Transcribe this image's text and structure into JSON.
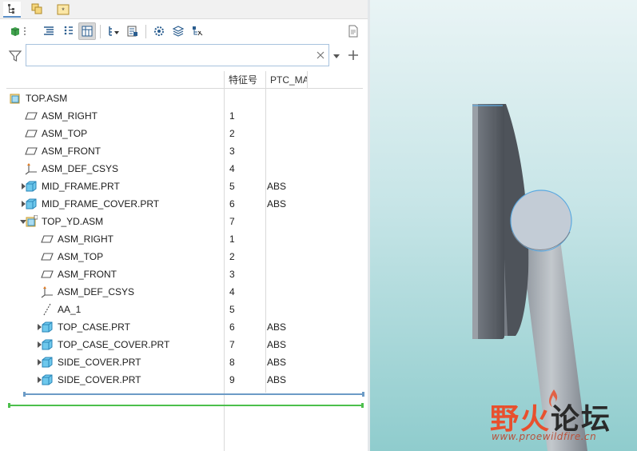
{
  "top_tabs": [
    {
      "name": "model-tree",
      "active": true
    },
    {
      "name": "layers",
      "active": false
    },
    {
      "name": "favorites",
      "active": false
    }
  ],
  "toolbar": {
    "buttons": [
      "show-display",
      "tree-columns",
      "tree-filters",
      "settings-table",
      "expand-filter",
      "model-info",
      "regenerate-settings",
      "layers-view",
      "tree-settings",
      "preview-doc"
    ]
  },
  "search": {
    "value": "",
    "placeholder": ""
  },
  "columns": {
    "feature_id": "特征号",
    "ptc": "PTC_MA"
  },
  "tree": [
    {
      "label": "TOP.ASM",
      "id": "",
      "ptc": "",
      "icon": "assembly",
      "level": 0,
      "arrow": ""
    },
    {
      "label": "ASM_RIGHT",
      "id": "1",
      "ptc": "",
      "icon": "plane",
      "level": 1,
      "arrow": ""
    },
    {
      "label": "ASM_TOP",
      "id": "2",
      "ptc": "",
      "icon": "plane",
      "level": 1,
      "arrow": ""
    },
    {
      "label": "ASM_FRONT",
      "id": "3",
      "ptc": "",
      "icon": "plane",
      "level": 1,
      "arrow": ""
    },
    {
      "label": "ASM_DEF_CSYS",
      "id": "4",
      "ptc": "",
      "icon": "csys",
      "level": 1,
      "arrow": ""
    },
    {
      "label": "MID_FRAME.PRT",
      "id": "5",
      "ptc": "ABS",
      "icon": "part",
      "level": 1,
      "arrow": "collapsed"
    },
    {
      "label": "MID_FRAME_COVER.PRT",
      "id": "6",
      "ptc": "ABS",
      "icon": "part",
      "level": 1,
      "arrow": "collapsed"
    },
    {
      "label": "TOP_YD.ASM",
      "id": "7",
      "ptc": "",
      "icon": "assembly-flex",
      "level": 1,
      "arrow": "expanded"
    },
    {
      "label": "ASM_RIGHT",
      "id": "1",
      "ptc": "",
      "icon": "plane",
      "level": 2,
      "arrow": ""
    },
    {
      "label": "ASM_TOP",
      "id": "2",
      "ptc": "",
      "icon": "plane",
      "level": 2,
      "arrow": ""
    },
    {
      "label": "ASM_FRONT",
      "id": "3",
      "ptc": "",
      "icon": "plane",
      "level": 2,
      "arrow": ""
    },
    {
      "label": "ASM_DEF_CSYS",
      "id": "4",
      "ptc": "",
      "icon": "csys",
      "level": 2,
      "arrow": ""
    },
    {
      "label": "AA_1",
      "id": "5",
      "ptc": "",
      "icon": "axis",
      "level": 2,
      "arrow": ""
    },
    {
      "label": "TOP_CASE.PRT",
      "id": "6",
      "ptc": "ABS",
      "icon": "part",
      "level": 2,
      "arrow": "collapsed"
    },
    {
      "label": "TOP_CASE_COVER.PRT",
      "id": "7",
      "ptc": "ABS",
      "icon": "part",
      "level": 2,
      "arrow": "collapsed"
    },
    {
      "label": "SIDE_COVER.PRT",
      "id": "8",
      "ptc": "ABS",
      "icon": "part",
      "level": 2,
      "arrow": "collapsed"
    },
    {
      "label": "SIDE_COVER.PRT",
      "id": "9",
      "ptc": "ABS",
      "icon": "part-flex",
      "level": 2,
      "arrow": "collapsed"
    }
  ],
  "watermark": {
    "part1": "野火",
    "part2": "论坛",
    "url": "www.proewildfire.cn"
  },
  "colors": {
    "accent": "#5a8fc8",
    "part": "#4fb3dd",
    "assembly": "#e7b84a",
    "insert_line": "#6c9bc6",
    "bottom_line": "#4cbf4c"
  }
}
